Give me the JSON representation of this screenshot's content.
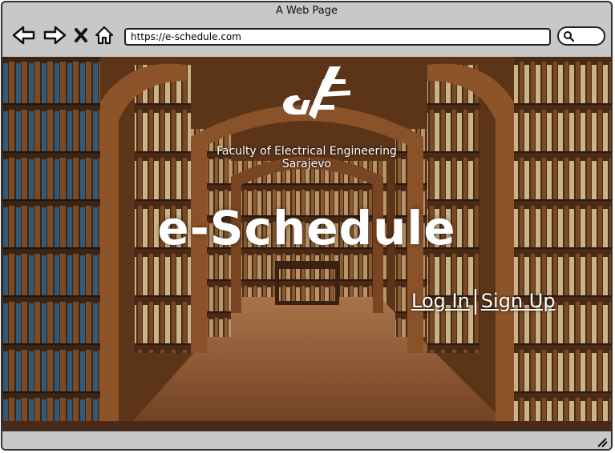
{
  "window": {
    "title": "A Web Page"
  },
  "toolbar": {
    "url": "https://e-schedule.com",
    "back_icon": "arrow-left-icon",
    "forward_icon": "arrow-right-icon",
    "close_icon": "x-icon",
    "home_icon": "home-icon",
    "search_icon": "search-icon"
  },
  "hero": {
    "faculty_line1": "Faculty of Electrical Engineering",
    "faculty_line2": "Sarajevo",
    "title": "e-Schedule",
    "login_label": "Log In",
    "signup_label": "Sign Up"
  }
}
